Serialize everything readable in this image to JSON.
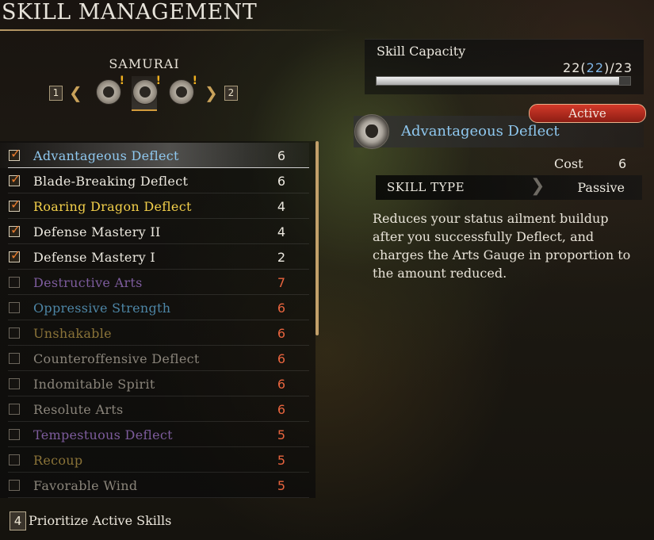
{
  "header": {
    "title": "SKILL MANAGEMENT"
  },
  "class_selector": {
    "name": "SAMURAI",
    "prev_key": "1",
    "next_key": "2",
    "prev_arrow": "❮",
    "next_arrow": "❯",
    "icons": [
      "samurai-icon-a",
      "samurai-icon-b",
      "samurai-icon-c"
    ],
    "selected_index": 1,
    "new_mark": "!"
  },
  "skills": [
    {
      "name": "Advantageous Deflect",
      "cost": "6",
      "equipped": true,
      "name_color": "#8fc8ef",
      "cost_color": "#ece8df",
      "selected": true
    },
    {
      "name": "Blade-Breaking Deflect",
      "cost": "6",
      "equipped": true,
      "name_color": "#ece8df",
      "cost_color": "#ece8df"
    },
    {
      "name": "Roaring Dragon Deflect",
      "cost": "4",
      "equipped": true,
      "name_color": "#f2cf4a",
      "cost_color": "#ece8df"
    },
    {
      "name": "Defense Mastery II",
      "cost": "4",
      "equipped": true,
      "name_color": "#ece8df",
      "cost_color": "#ece8df"
    },
    {
      "name": "Defense Mastery I",
      "cost": "2",
      "equipped": true,
      "name_color": "#ece8df",
      "cost_color": "#ece8df"
    },
    {
      "name": "Destructive Arts",
      "cost": "7",
      "equipped": false,
      "name_color": "#7d5c9d",
      "cost_color": "#e8643e"
    },
    {
      "name": "Oppressive Strength",
      "cost": "6",
      "equipped": false,
      "name_color": "#4d86a6",
      "cost_color": "#e8643e"
    },
    {
      "name": "Unshakable",
      "cost": "6",
      "equipped": false,
      "name_color": "#8a7338",
      "cost_color": "#e8643e"
    },
    {
      "name": "Counteroffensive Deflect",
      "cost": "6",
      "equipped": false,
      "name_color": "#8a847a",
      "cost_color": "#e8643e"
    },
    {
      "name": "Indomitable Spirit",
      "cost": "6",
      "equipped": false,
      "name_color": "#8a847a",
      "cost_color": "#e8643e"
    },
    {
      "name": "Resolute Arts",
      "cost": "6",
      "equipped": false,
      "name_color": "#8a847a",
      "cost_color": "#e8643e"
    },
    {
      "name": "Tempestuous Deflect",
      "cost": "5",
      "equipped": false,
      "name_color": "#7d5c9d",
      "cost_color": "#e8643e"
    },
    {
      "name": "Recoup",
      "cost": "5",
      "equipped": false,
      "name_color": "#8a7338",
      "cost_color": "#e8643e"
    },
    {
      "name": "Favorable Wind",
      "cost": "5",
      "equipped": false,
      "name_color": "#8a847a",
      "cost_color": "#e8643e"
    }
  ],
  "footer": {
    "key": "4",
    "label": "Prioritize Active Skills"
  },
  "capacity": {
    "label": "Skill Capacity",
    "used": "22",
    "used_preview": "22",
    "max": "23",
    "fill_fraction": 0.9565
  },
  "detail": {
    "status_badge": "Active",
    "title": "Advantageous Deflect",
    "cost_label": "Cost",
    "cost": "6",
    "type_label": "SKILL TYPE",
    "type_separator": "❯",
    "type_value": "Passive",
    "description": "Reduces your status ailment buildup after you successfully Deflect, and charges the Arts Gauge in proportion to the amount reduced."
  },
  "colors": {
    "accent_gold": "#c9a25a",
    "active_red": "#d43a2a",
    "highlight_blue": "#8fc8ef"
  }
}
